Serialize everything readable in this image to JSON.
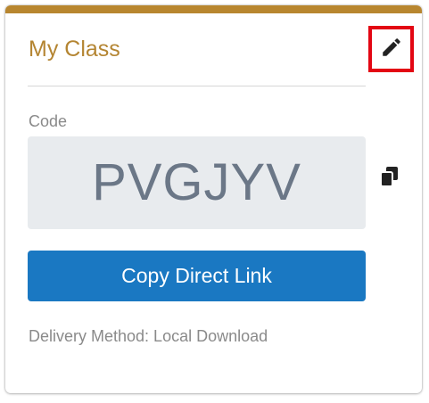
{
  "card": {
    "title": "My Class",
    "code_label": "Code",
    "code_value": "PVGJYV",
    "copy_link_label": "Copy Direct Link",
    "delivery_text": "Delivery Method: Local Download"
  },
  "icons": {
    "edit": "pencil-icon",
    "copy": "copy-icon"
  },
  "colors": {
    "accent": "#b8862f",
    "title": "#b48532",
    "primary_button": "#1a78c2",
    "code_box": "#e8ebee",
    "highlight_border": "#e30613"
  }
}
